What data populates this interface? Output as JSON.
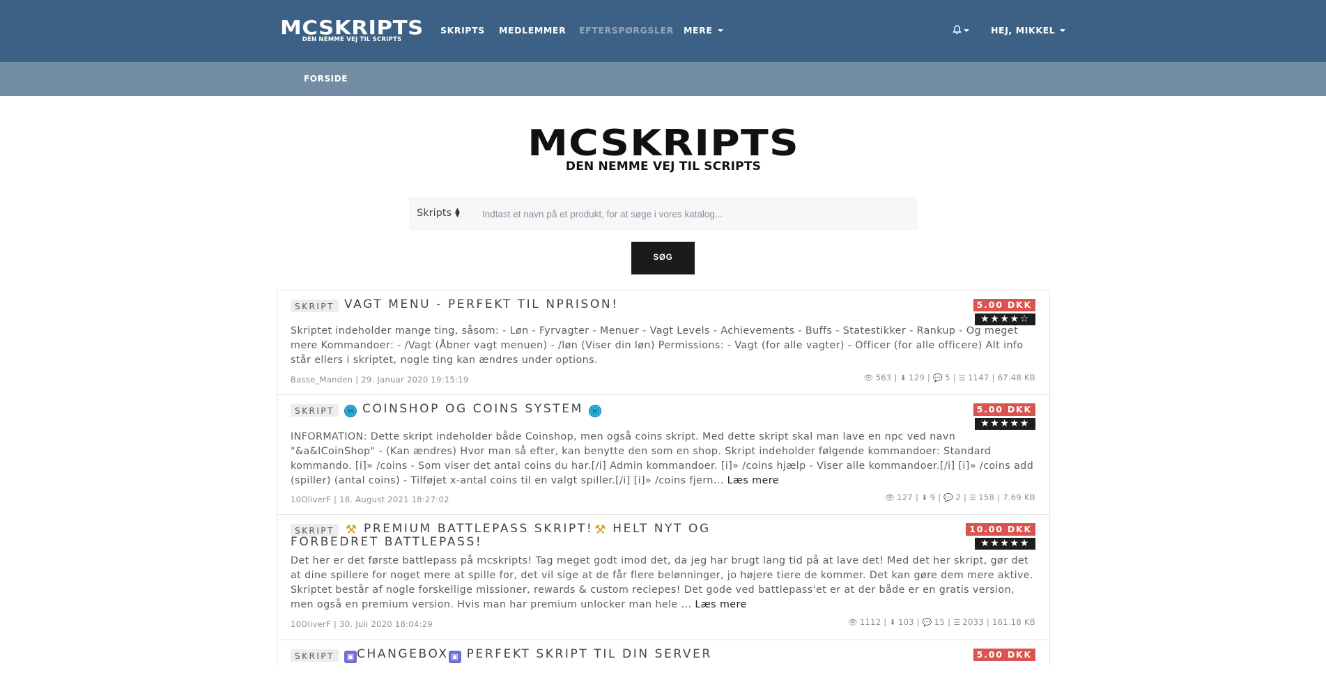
{
  "nav": {
    "logo_main": "MCSKRIPTS",
    "logo_tagline": "DEN NEMME VEJ TIL SCRIPTS",
    "items": [
      "SKRIPTS",
      "MEDLEMMER",
      "EFTERSPØRGSLER",
      "MERE"
    ],
    "user_greeting": "HEJ, MIKKEL",
    "bell_icon": "bell-icon"
  },
  "subnav": {
    "home": "FORSIDE"
  },
  "hero": {
    "logo_main": "MCSKRIPTS",
    "logo_tagline": "DEN NEMME VEJ TIL SCRIPTS"
  },
  "search": {
    "category": "Skripts",
    "placeholder": "Indtast et navn på et produkt, for at søge i vores katalog...",
    "button": "SØG"
  },
  "listings": [
    {
      "type": "SKRIPT",
      "title": "VAGT MENU - PERFEKT TIL NPRISON!",
      "price": "5.00 DKK",
      "stars": "★★★★☆",
      "rating": 4,
      "description": "Skriptet indeholder mange ting, såsom: - Løn - Fyrvagter - Menuer - Vagt Levels - Achievements - Buffs - Statestikker - Rankup - Og meget mere Kommandoer: - /Vagt (Åbner vagt menuen) - /løn (Viser din løn) Permissions: - Vagt (for alle vagter) - Officer (for alle officere) Alt info står ellers i skriptet, nogle ting kan ændres under options.",
      "more": "",
      "meta": "Basse_Manden | 29. Januar 2020 19:15:19",
      "views": "563",
      "downloads": "129",
      "comments": "5",
      "lines": "1147",
      "size": "67.48 KB"
    },
    {
      "type": "SKRIPT",
      "title_pre_icon": "Ⓜ",
      "title": "COINSHOP OG COINS SYSTEM",
      "title_post_icon": "Ⓜ",
      "price": "5.00 DKK",
      "stars": "★★★★★",
      "rating": 5,
      "description": "INFORMATION: Dette skript indeholder både Coinshop, men også coins skript. Med dette skript skal man lave en npc ved navn \"&a&lCoinShop\" - (Kan ændres) Hvor man så efter, kan benytte den som en shop. Skript indeholder følgende kommandoer: Standard kommando. [i]» /coins - Som viser det antal coins du har.[/i] Admin kommandoer. [i]» /coins hjælp - Viser alle kommandoer.[/i] [i]» /coins add (spiller) (antal coins) - Tilføjet x-antal coins til en valgt spiller.[/i] [i]» /coins fjern...",
      "more": "Læs mere",
      "meta": "10OliverF | 18. August 2021 18:27:02",
      "views": "127",
      "downloads": "9",
      "comments": "2",
      "lines": "158",
      "size": "7.69 KB"
    },
    {
      "type": "SKRIPT",
      "title_pre_icon": "⚒",
      "title": "PREMIUM BATTLEPASS SKRIPT!",
      "title_mid_icon": "⚒",
      "title_line2": "HELT NYT OG",
      "title_line3": "FORBEDRET BATTLEPASS!",
      "price": "10.00 DKK",
      "stars": "★★★★★",
      "rating": 5,
      "description": "Det her er det første battlepass på mcskripts! Tag meget godt imod det, da jeg har brugt lang tid på at lave det! Med det her skript, gør det at dine spillere for noget mere at spille for, det vil sige at de får flere belønninger, jo højere tiere de kommer. Det kan gøre dem mere aktive. Skriptet består af nogle forskellige missioner, rewards & custom reciepes! Det gode ved battlepass'et er at der både er en gratis version, men også en premium version. Hvis man har premium unlocker man hele ...",
      "more": "Læs mere",
      "meta": "10OliverF | 30. Juli 2020 18:04:29",
      "views": "1112",
      "downloads": "103",
      "comments": "15",
      "lines": "2033",
      "size": "161.18 KB"
    },
    {
      "type": "SKRIPT",
      "title_pre_icon": "▣",
      "title": "CHANGEBOX",
      "title_post_icon": "▣",
      "title_rest": "PERFEKT SKRIPT TIL DIN SERVER",
      "price": "5.00 DKK"
    }
  ],
  "colors": {
    "navbar": "#3c6184",
    "subnav": "#718ca3",
    "price": "#d9534f",
    "stars_bg": "#1d1d1d"
  }
}
